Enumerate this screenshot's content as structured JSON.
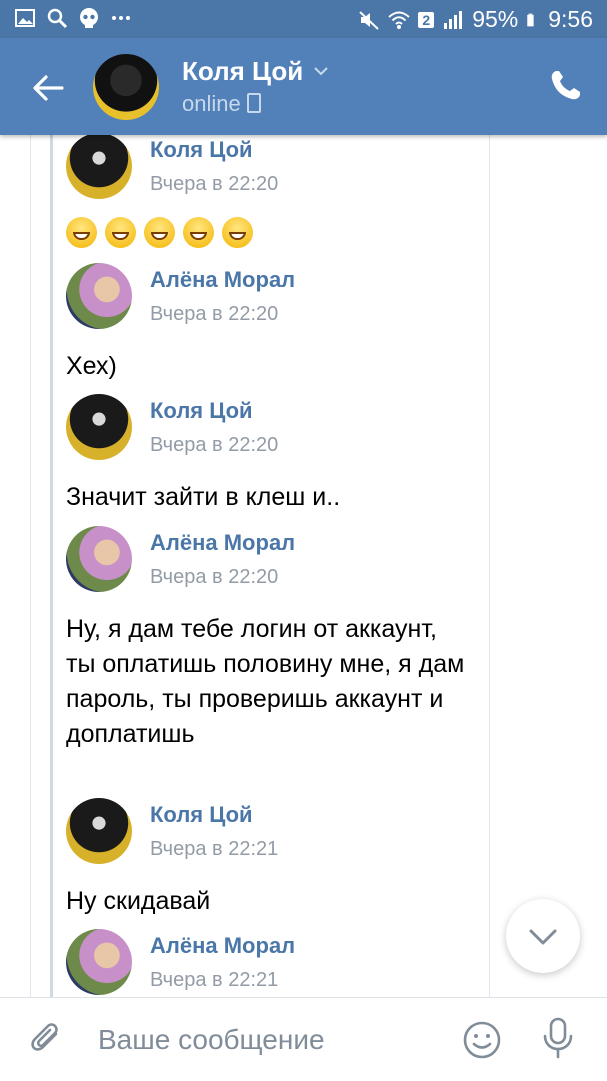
{
  "status_bar": {
    "battery": "95%",
    "time": "9:56",
    "sim_badge": "2"
  },
  "header": {
    "name": "Коля Цой",
    "status": "online"
  },
  "messages": [
    {
      "author": "Коля Цой",
      "time": "Вчера в 22:20",
      "avatar": "kolya",
      "emoji_count": 5
    },
    {
      "author": "Алёна Морал",
      "time": "Вчера в 22:20",
      "avatar": "alena",
      "text": "Хех)"
    },
    {
      "author": "Коля Цой",
      "time": "Вчера в 22:20",
      "avatar": "kolya",
      "text": "Значит зайти в клеш и.."
    },
    {
      "author": "Алёна Морал",
      "time": "Вчера в 22:20",
      "avatar": "alena",
      "text": "Ну, я дам тебе логин от аккаунт, ты оплатишь половину мне, я дам пароль, ты проверишь аккаунт и доплатишь"
    },
    {
      "author": "Коля Цой",
      "time": "Вчера в 22:21",
      "avatar": "kolya",
      "text": "Ну скидавай"
    },
    {
      "author": "Алёна Морал",
      "time": "Вчера в 22:21",
      "avatar": "alena"
    }
  ],
  "composer": {
    "placeholder": "Ваше сообщение"
  },
  "icons": {
    "back": "arrow-left-icon",
    "call": "phone-icon",
    "attach": "paperclip-icon",
    "emoji": "smile-icon",
    "mic": "microphone-icon",
    "scroll": "chevron-down-icon"
  },
  "colors": {
    "header_bg": "#5181b8",
    "author_name": "#4a76a8",
    "timestamp": "#939ba6"
  }
}
